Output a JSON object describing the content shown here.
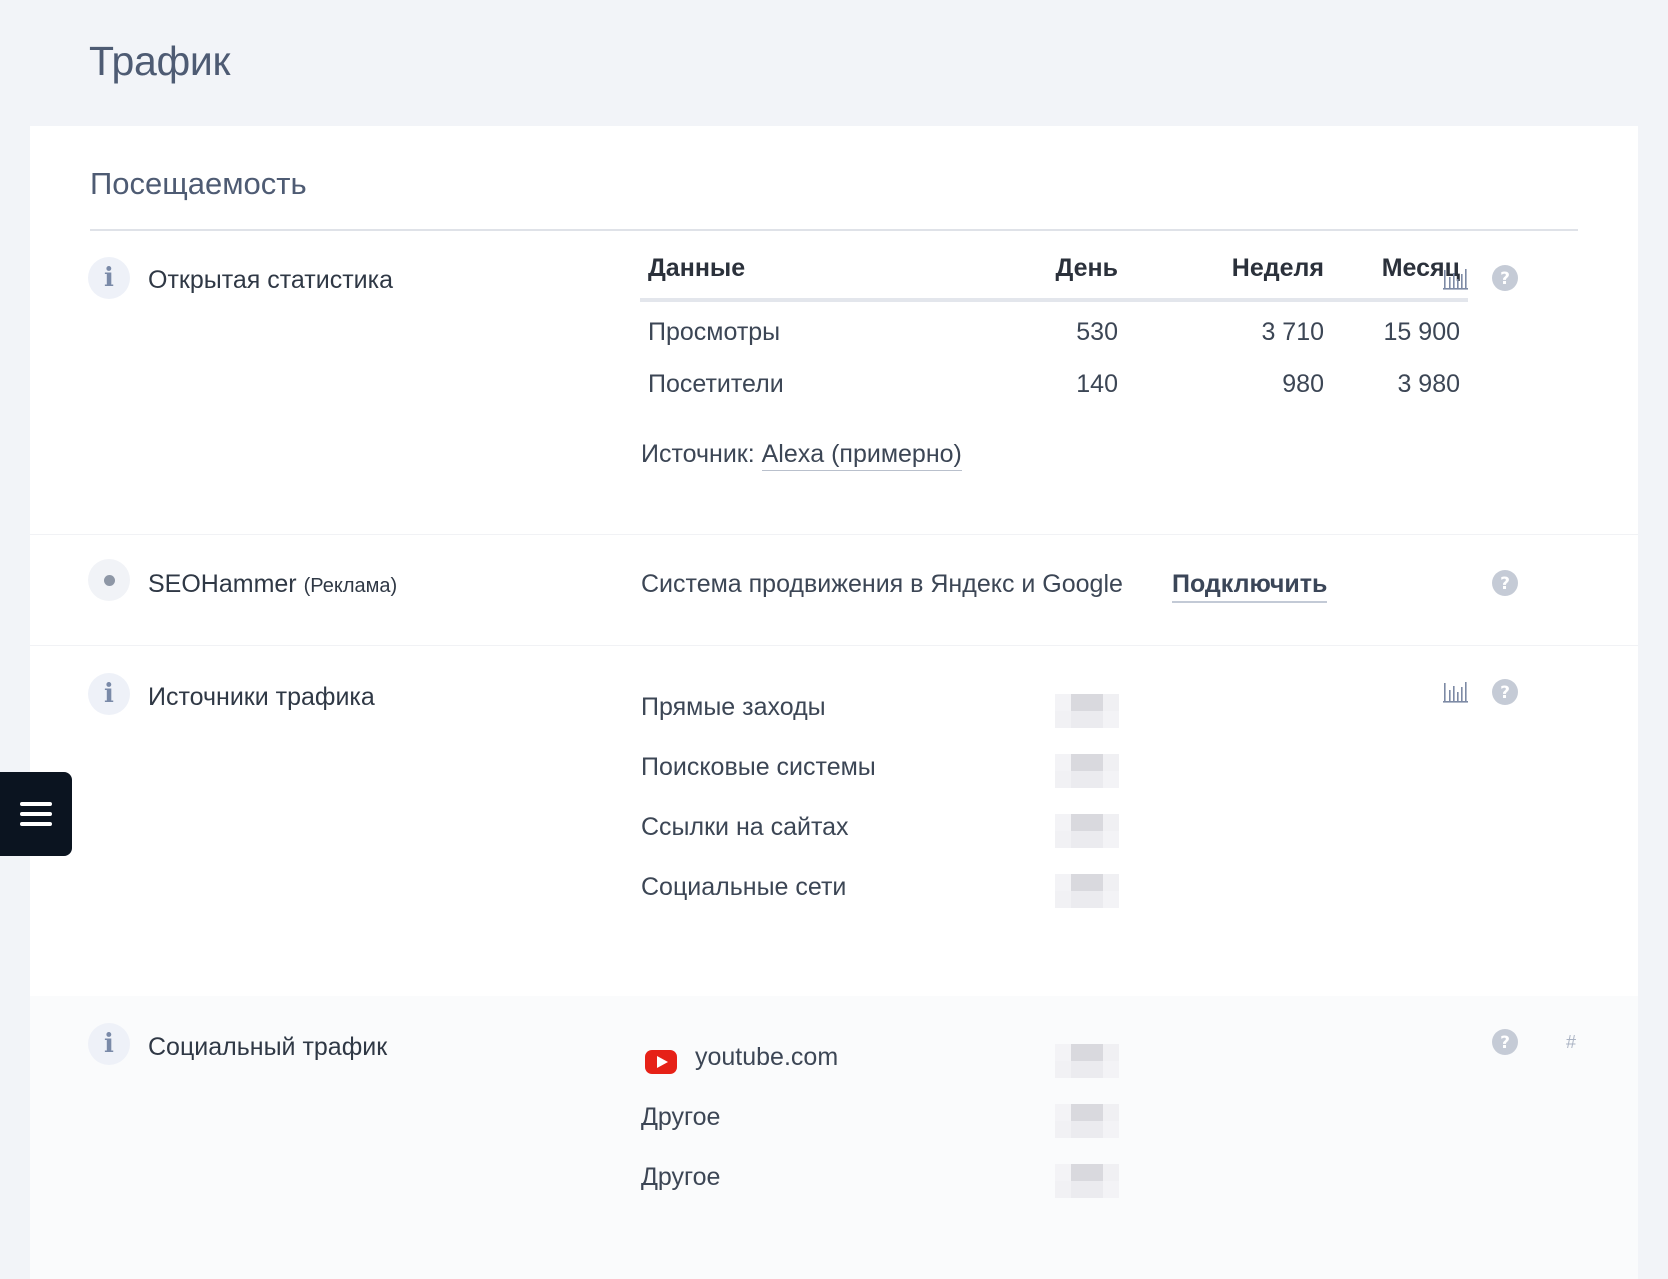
{
  "page": {
    "title": "Трафик"
  },
  "card": {
    "title": "Посещаемость"
  },
  "open_stats": {
    "label": "Открытая статистика",
    "columns": [
      "Данные",
      "День",
      "Неделя",
      "Месяц"
    ],
    "rows": [
      {
        "name": "Просмотры",
        "day": "530",
        "week": "3 710",
        "month": "15 900"
      },
      {
        "name": "Посетители",
        "day": "140",
        "week": "980",
        "month": "3 980"
      }
    ],
    "source_prefix": "Источник:",
    "source_link": "Alexa (примерно)"
  },
  "seohammer": {
    "label": "SEOHammer",
    "tag": "(Реклама)",
    "description": "Система продвижения в Яндекс и Google",
    "connect_label": "Подключить"
  },
  "traffic_sources": {
    "label": "Источники трафика",
    "items": [
      "Прямые заходы",
      "Поисковые системы",
      "Ссылки на сайтах",
      "Социальные сети"
    ]
  },
  "social_traffic": {
    "label": "Социальный трафик",
    "items": [
      "youtube.com",
      "Другое",
      "Другое"
    ],
    "anchor": "#"
  },
  "icons": {
    "info": "info-icon",
    "help": "question-circle-icon",
    "chart": "bar-chart-icon",
    "menu": "hamburger-menu-icon",
    "youtube": "youtube-icon"
  },
  "colors": {
    "background": "#f2f4f8",
    "card": "#ffffff",
    "title": "#4e5b73",
    "youtube": "#e62117",
    "menu_button": "#0b1420"
  }
}
